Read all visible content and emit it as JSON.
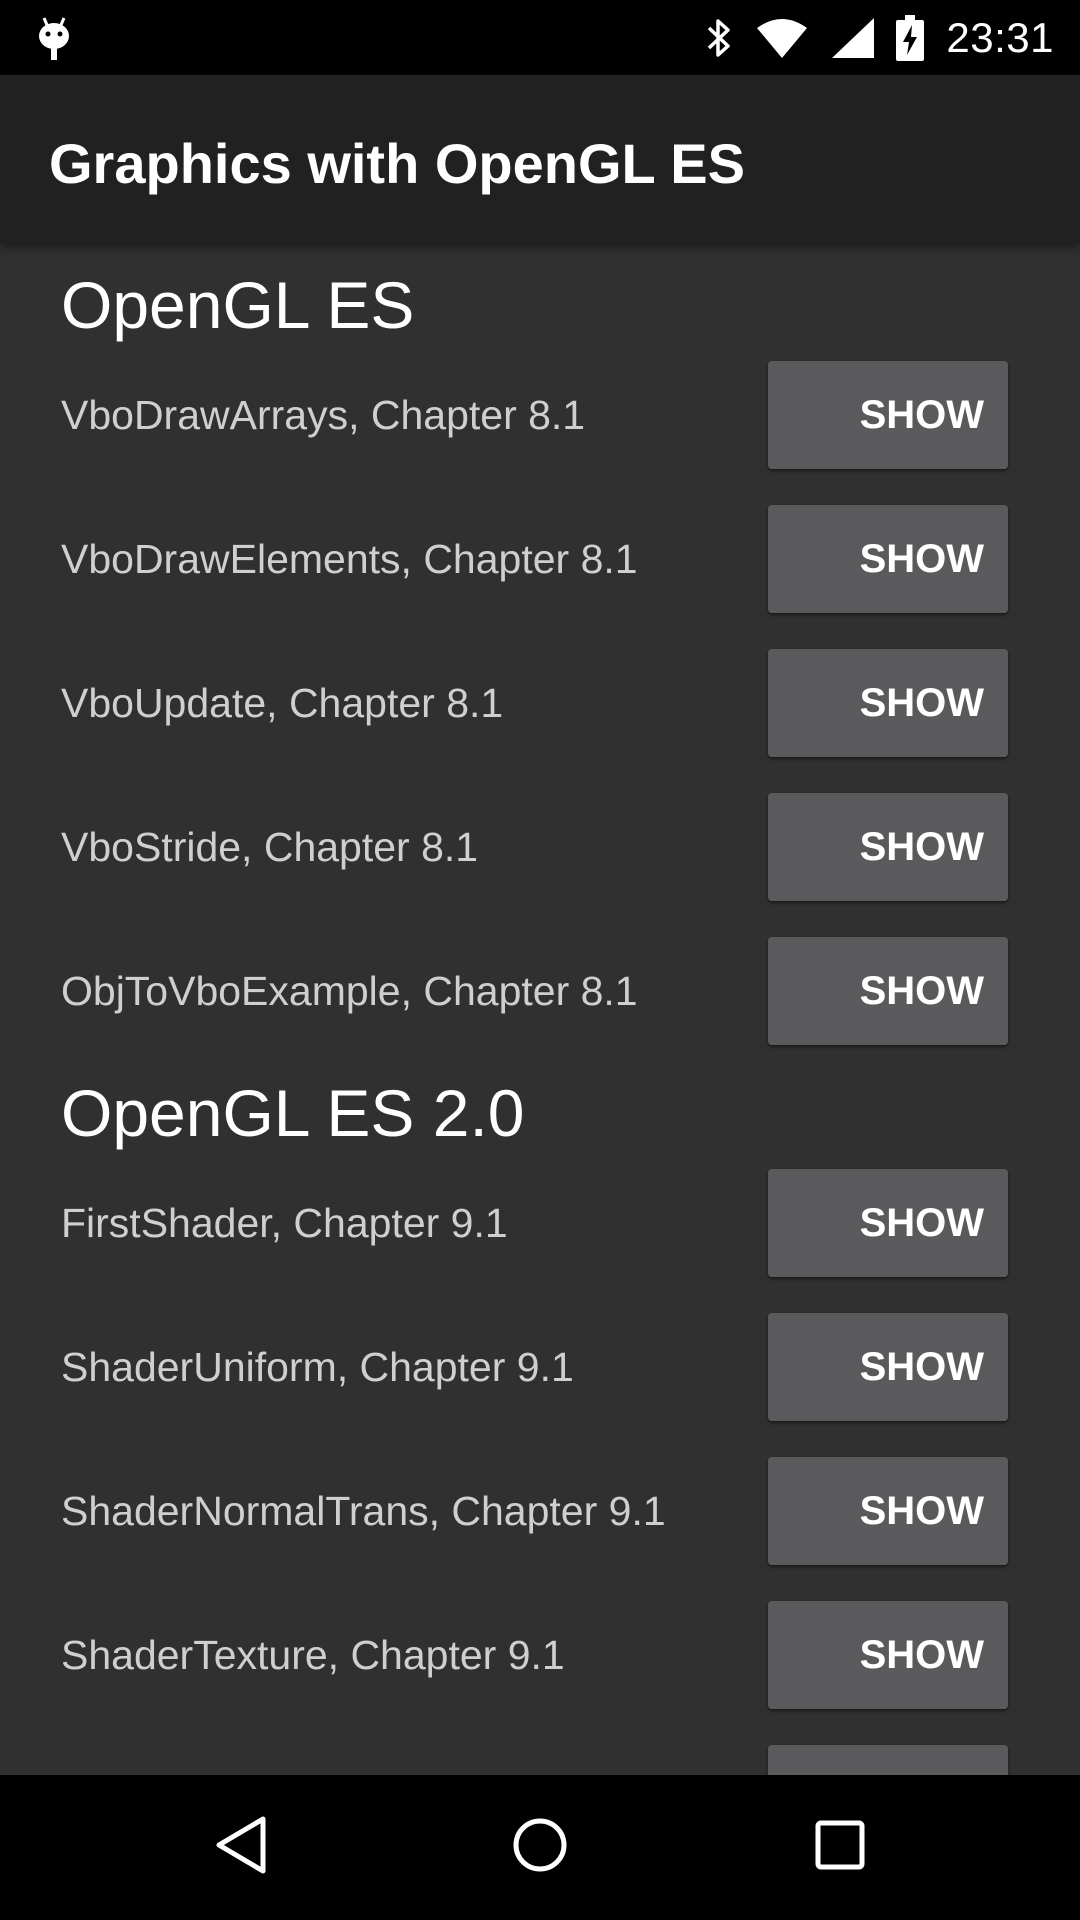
{
  "status_bar": {
    "time": "23:31",
    "icons": [
      "android-debug-icon",
      "bluetooth-icon",
      "wifi-icon",
      "cell-signal-icon",
      "battery-charging-icon"
    ]
  },
  "app_bar": {
    "title": "Graphics with OpenGL ES"
  },
  "sections": [
    {
      "heading": "OpenGL ES",
      "items": [
        {
          "label": "VboDrawArrays, Chapter 8.1",
          "button": "SHOW"
        },
        {
          "label": "VboDrawElements, Chapter 8.1",
          "button": "SHOW"
        },
        {
          "label": "VboUpdate, Chapter 8.1",
          "button": "SHOW"
        },
        {
          "label": "VboStride, Chapter 8.1",
          "button": "SHOW"
        },
        {
          "label": "ObjToVboExample, Chapter 8.1",
          "button": "SHOW"
        }
      ]
    },
    {
      "heading": "OpenGL ES 2.0",
      "items": [
        {
          "label": "FirstShader, Chapter 9.1",
          "button": "SHOW"
        },
        {
          "label": "ShaderUniform, Chapter 9.1",
          "button": "SHOW"
        },
        {
          "label": "ShaderNormalTrans, Chapter 9.1",
          "button": "SHOW"
        },
        {
          "label": "ShaderTexture, Chapter 9.1",
          "button": "SHOW"
        }
      ]
    }
  ],
  "nav_bar": {
    "icons": [
      "back-icon",
      "home-icon",
      "recents-icon"
    ]
  },
  "colors": {
    "background": "#303030",
    "app_bar": "#212121",
    "button": "#5a5a5c",
    "label_text": "#cfcfcf",
    "system_bars": "#000000"
  }
}
